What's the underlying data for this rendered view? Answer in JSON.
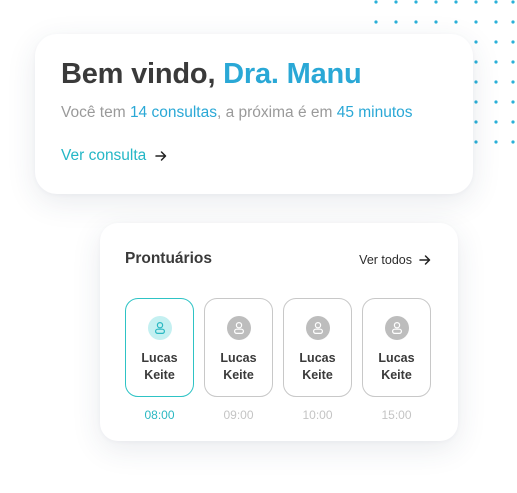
{
  "welcome": {
    "greeting": "Bem vindo, ",
    "doctor_name": "Dra. Manu",
    "sub_prefix": "Você tem ",
    "consult_count": "14 consultas",
    "sub_middle": ", a próxima é em ",
    "next_in": "45 minutos",
    "link_label": "Ver consulta",
    "link_icon": "arrow-right-icon"
  },
  "records": {
    "title": "Prontuários",
    "see_all_label": "Ver todos",
    "see_all_icon": "arrow-right-icon",
    "patients": [
      {
        "first": "Lucas",
        "last": "Keite",
        "time": "08:00",
        "selected": true,
        "icon": "user-icon"
      },
      {
        "first": "Lucas",
        "last": "Keite",
        "time": "09:00",
        "selected": false,
        "icon": "user-icon"
      },
      {
        "first": "Lucas",
        "last": "Keite",
        "time": "10:00",
        "selected": false,
        "icon": "user-icon"
      },
      {
        "first": "Lucas",
        "last": "Keite",
        "time": "15:00",
        "selected": false,
        "icon": "user-icon"
      }
    ]
  },
  "colors": {
    "accent_blue": "#2aa8d6",
    "accent_teal": "#24b7c6",
    "selected_border": "#2ec3c5",
    "text_dark": "#3a3a3a",
    "text_muted": "#9a9a9a",
    "dots": "#2ab0d8"
  }
}
